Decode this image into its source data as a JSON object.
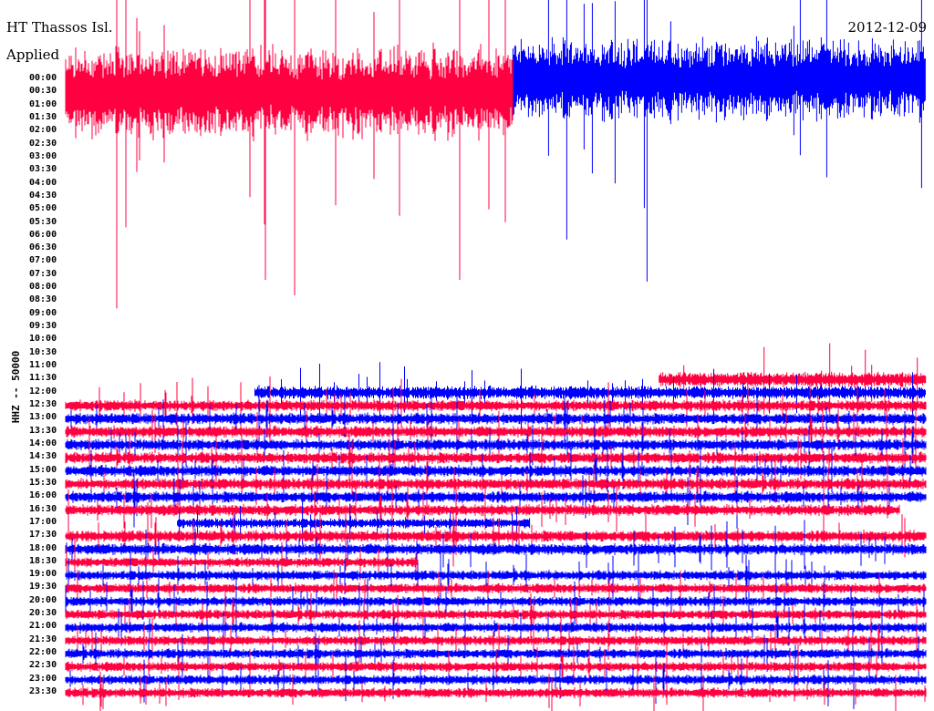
{
  "header": {
    "station": "HT Thassos Isl.",
    "subtitle": "Applied",
    "date": "2012-12-09"
  },
  "chart_data": {
    "type": "line",
    "title": "HT Thassos Isl.",
    "date": "2012-12-09",
    "ylabel": "HHZ -- 50000",
    "xlabel": "",
    "colors": {
      "odd_rows": "#ff0040",
      "even_rows": "#0000ff"
    },
    "y_ticks": [
      "00:00",
      "00:30",
      "01:00",
      "01:30",
      "02:00",
      "02:30",
      "03:00",
      "03:30",
      "04:00",
      "04:30",
      "05:00",
      "05:30",
      "06:00",
      "06:30",
      "07:00",
      "07:30",
      "08:00",
      "08:30",
      "09:00",
      "09:30",
      "10:00",
      "10:30",
      "11:00",
      "11:30",
      "12:00",
      "12:30",
      "13:00",
      "13:30",
      "14:00",
      "14:30",
      "15:00",
      "15:30",
      "16:00",
      "16:30",
      "17:00",
      "17:30",
      "18:00",
      "18:30",
      "19:00",
      "19:30",
      "20:00",
      "20:30",
      "21:00",
      "21:30",
      "22:00",
      "22:30",
      "23:00",
      "23:30"
    ],
    "series_note": "relative trace amplitude per 30-minute line; start/end as fraction of line",
    "series": [
      {
        "row": 0,
        "amplitude": 50,
        "start": 0.52,
        "end": 1.0
      },
      {
        "row": 1,
        "amplitude": 55,
        "start": 0.0,
        "end": 0.52
      },
      {
        "row": 23,
        "amplitude": 9,
        "start": 0.69,
        "end": 1.0
      },
      {
        "row": 24,
        "amplitude": 8,
        "start": 0.22,
        "end": 1.0
      },
      {
        "row": 25,
        "amplitude": 7,
        "start": 0.0,
        "end": 1.0
      },
      {
        "row": 26,
        "amplitude": 7,
        "start": 0.0,
        "end": 1.0
      },
      {
        "row": 27,
        "amplitude": 7,
        "start": 0.0,
        "end": 1.0
      },
      {
        "row": 28,
        "amplitude": 7,
        "start": 0.0,
        "end": 1.0
      },
      {
        "row": 29,
        "amplitude": 7,
        "start": 0.0,
        "end": 1.0
      },
      {
        "row": 30,
        "amplitude": 7,
        "start": 0.0,
        "end": 1.0
      },
      {
        "row": 31,
        "amplitude": 7,
        "start": 0.0,
        "end": 1.0
      },
      {
        "row": 32,
        "amplitude": 7,
        "start": 0.0,
        "end": 1.0
      },
      {
        "row": 33,
        "amplitude": 7,
        "start": 0.0,
        "end": 0.97
      },
      {
        "row": 34,
        "amplitude": 6,
        "start": 0.13,
        "end": 0.54
      },
      {
        "row": 35,
        "amplitude": 7,
        "start": 0.0,
        "end": 1.0
      },
      {
        "row": 36,
        "amplitude": 7,
        "start": 0.0,
        "end": 1.0
      },
      {
        "row": 37,
        "amplitude": 6,
        "start": 0.0,
        "end": 0.41
      },
      {
        "row": 38,
        "amplitude": 6,
        "start": 0.0,
        "end": 1.0
      },
      {
        "row": 39,
        "amplitude": 6,
        "start": 0.0,
        "end": 1.0
      },
      {
        "row": 40,
        "amplitude": 6,
        "start": 0.0,
        "end": 1.0
      },
      {
        "row": 41,
        "amplitude": 6,
        "start": 0.0,
        "end": 1.0
      },
      {
        "row": 42,
        "amplitude": 6,
        "start": 0.0,
        "end": 1.0
      },
      {
        "row": 43,
        "amplitude": 6,
        "start": 0.0,
        "end": 1.0
      },
      {
        "row": 44,
        "amplitude": 6,
        "start": 0.0,
        "end": 1.0
      },
      {
        "row": 45,
        "amplitude": 6,
        "start": 0.0,
        "end": 1.0
      },
      {
        "row": 46,
        "amplitude": 6,
        "start": 0.0,
        "end": 1.0
      },
      {
        "row": 47,
        "amplitude": 6,
        "start": 0.0,
        "end": 1.0
      }
    ]
  }
}
